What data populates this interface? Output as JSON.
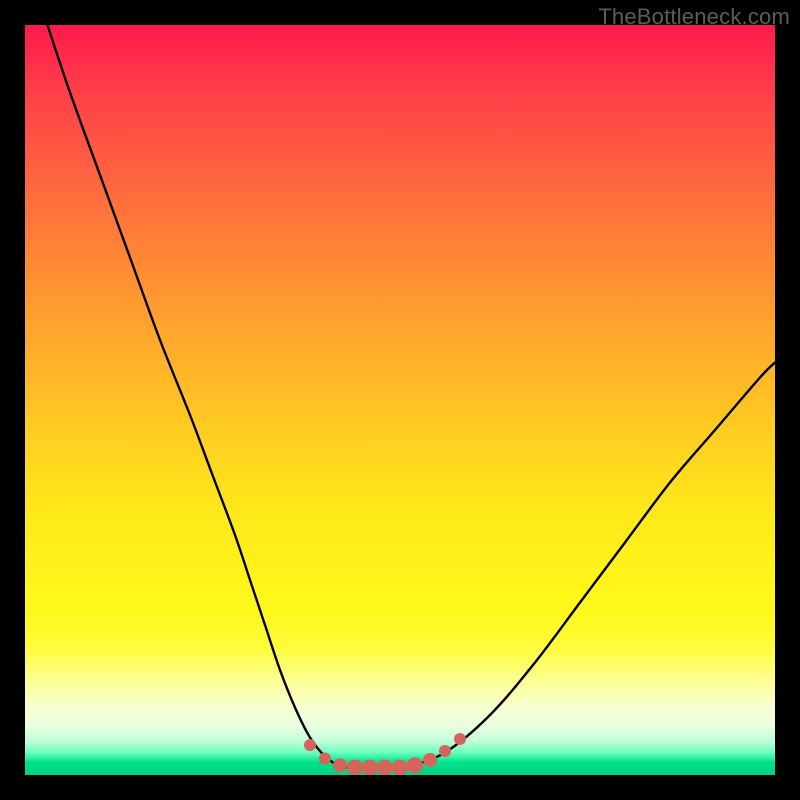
{
  "watermark": "TheBottleneck.com",
  "chart_data": {
    "type": "line",
    "title": "",
    "xlabel": "",
    "ylabel": "",
    "xlim": [
      0,
      100
    ],
    "ylim": [
      0,
      100
    ],
    "series": [
      {
        "name": "bottleneck-curve",
        "x": [
          3,
          6,
          10,
          14,
          18,
          22,
          25,
          28,
          30,
          32,
          34,
          36,
          38,
          40,
          42,
          44,
          47,
          51,
          56,
          62,
          68,
          74,
          80,
          86,
          92,
          98,
          100
        ],
        "y": [
          100,
          91,
          80,
          69,
          58,
          48,
          40,
          32,
          26,
          20,
          14,
          9,
          5,
          2.5,
          1.2,
          1,
          1,
          1.2,
          3,
          8,
          15,
          23,
          31,
          39,
          46,
          53,
          55
        ]
      }
    ],
    "markers": {
      "name": "bottom-dots",
      "color": "#d6645c",
      "points": [
        {
          "x": 38,
          "y": 4.0,
          "r": 6
        },
        {
          "x": 40,
          "y": 2.2,
          "r": 6
        },
        {
          "x": 42,
          "y": 1.3,
          "r": 7
        },
        {
          "x": 44,
          "y": 1.0,
          "r": 8
        },
        {
          "x": 46,
          "y": 1.0,
          "r": 8
        },
        {
          "x": 48,
          "y": 1.0,
          "r": 8
        },
        {
          "x": 50,
          "y": 1.0,
          "r": 8
        },
        {
          "x": 52,
          "y": 1.3,
          "r": 8
        },
        {
          "x": 54,
          "y": 2.0,
          "r": 7
        },
        {
          "x": 56,
          "y": 3.2,
          "r": 6
        },
        {
          "x": 58,
          "y": 4.8,
          "r": 6
        }
      ]
    },
    "gradient_stops": [
      {
        "pos": 0,
        "color": "#ff1a4d"
      },
      {
        "pos": 22,
        "color": "#ff6a3f"
      },
      {
        "pos": 45,
        "color": "#ffb22a"
      },
      {
        "pos": 65,
        "color": "#ffe81a"
      },
      {
        "pos": 88,
        "color": "#fdffa0"
      },
      {
        "pos": 97,
        "color": "#6affc0"
      },
      {
        "pos": 100,
        "color": "#00d084"
      }
    ]
  }
}
